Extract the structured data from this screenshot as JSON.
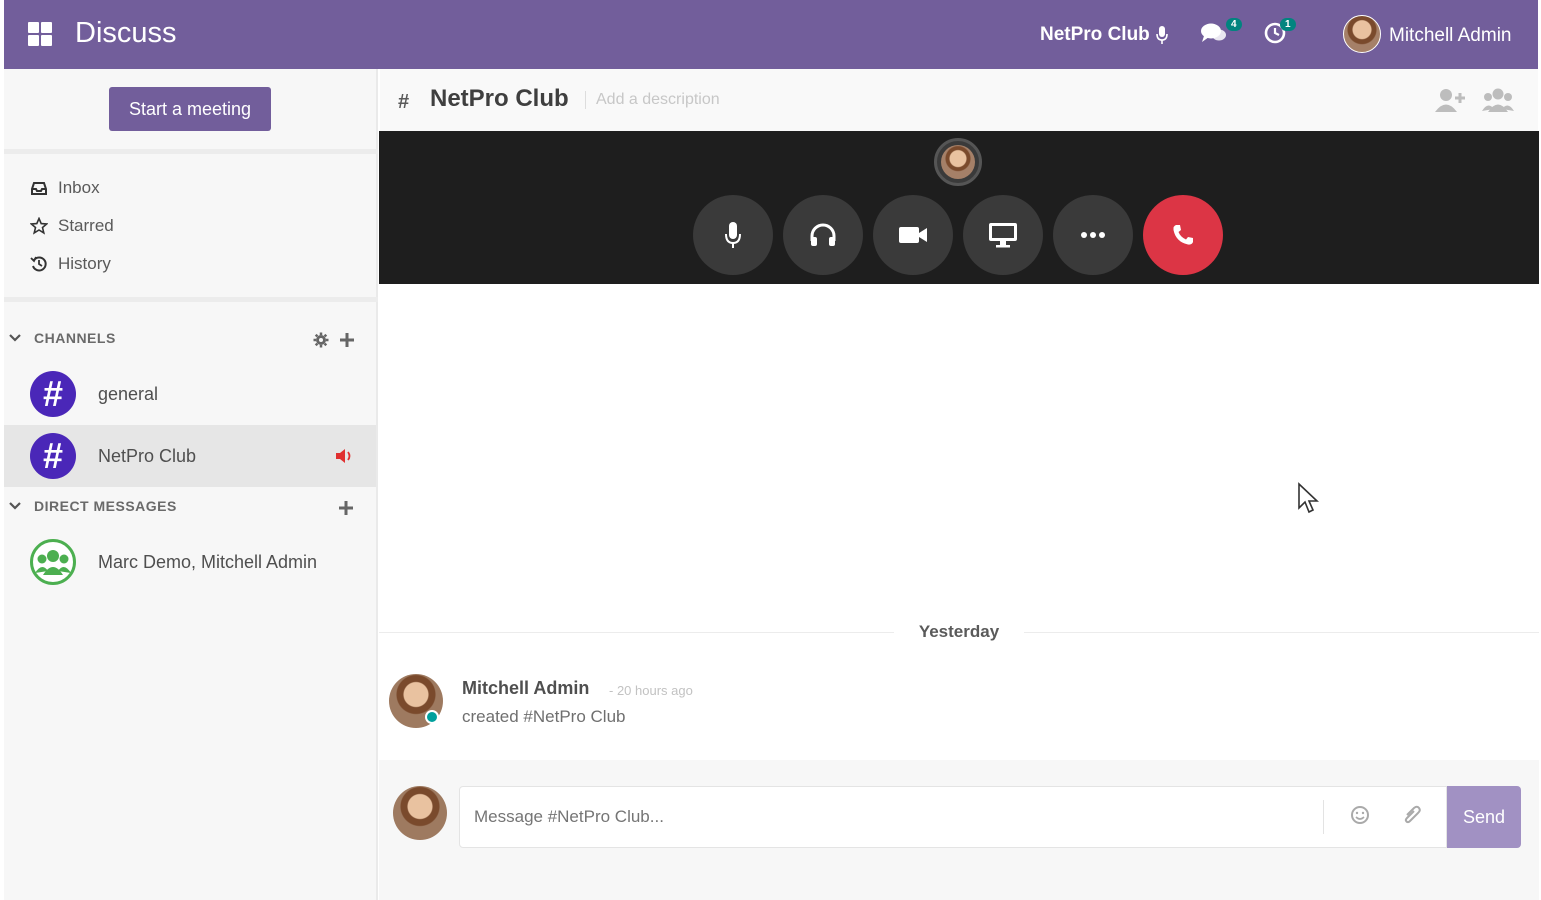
{
  "navbar": {
    "app_title": "Discuss",
    "call_channel": "NetPro Club",
    "messages_badge": "4",
    "activity_badge": "1",
    "user_name": "Mitchell Admin",
    "icons": [
      "apps-icon",
      "microphone-icon",
      "chat-icon",
      "clock-icon"
    ]
  },
  "sidebar": {
    "start_meeting": "Start a meeting",
    "mailboxes": [
      {
        "label": "Inbox",
        "icon": "inbox-icon"
      },
      {
        "label": "Starred",
        "icon": "star-icon"
      },
      {
        "label": "History",
        "icon": "history-icon"
      }
    ],
    "channels_header": "CHANNELS",
    "channels": [
      {
        "label": "general",
        "active": false
      },
      {
        "label": "NetPro Club",
        "active": true
      }
    ],
    "dm_header": "DIRECT MESSAGES",
    "direct_messages": [
      {
        "label": "Marc Demo, Mitchell Admin"
      }
    ]
  },
  "thread_header": {
    "hash": "#",
    "channel_name": "NetPro Club",
    "description_placeholder": "Add a description"
  },
  "thread": {
    "date_separator": "Yesterday",
    "messages": [
      {
        "author": "Mitchell Admin",
        "date": "- 20 hours ago",
        "body": "created #NetPro Club"
      }
    ]
  },
  "composer": {
    "placeholder": "Message #NetPro Club...",
    "send_label": "Send"
  },
  "colors": {
    "brand": "#725e9b",
    "hangup": "#dc3545",
    "channel_avatar": "#4a27b8",
    "online": "#00a09d"
  }
}
